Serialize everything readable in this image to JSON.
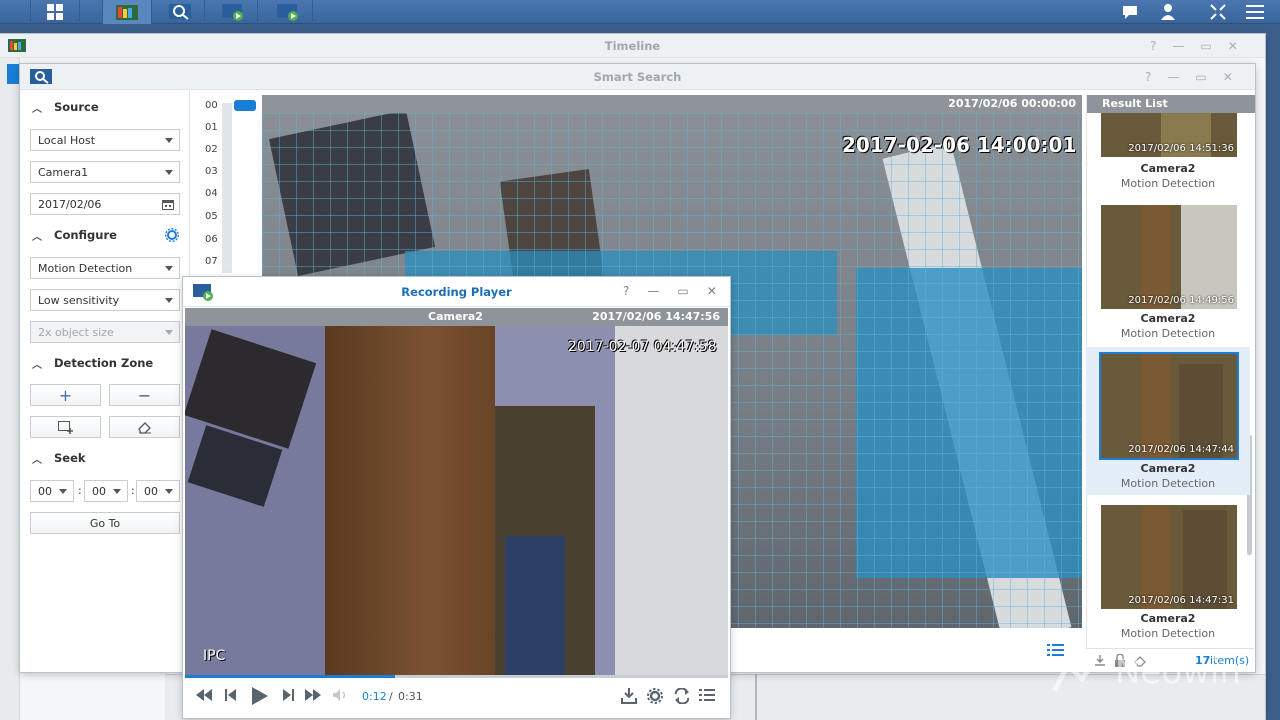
{
  "taskbar": {
    "icons": [
      "main-menu-icon",
      "timeline-app-icon",
      "smart-search-app-icon",
      "recording-player-app-icon",
      "recording-player-app-icon"
    ],
    "right_icons": [
      "notifications-icon",
      "user-icon",
      "fullscreen-icon",
      "menu-icon"
    ]
  },
  "timeline_window": {
    "title": "Timeline"
  },
  "smart_search": {
    "title": "Smart Search",
    "source": {
      "heading": "Source",
      "host": "Local Host",
      "camera": "Camera1",
      "date": "2017/02/06"
    },
    "configure": {
      "heading": "Configure",
      "mode": "Motion Detection",
      "sensitivity": "Low sensitivity",
      "object_size": "2x object size"
    },
    "detection_zone": {
      "heading": "Detection Zone"
    },
    "seek": {
      "heading": "Seek",
      "h": "00",
      "m": "00",
      "s": "00",
      "sep": ":",
      "goto": "Go To"
    },
    "hours": [
      "00",
      "01",
      "02",
      "03",
      "04",
      "05",
      "06",
      "07"
    ],
    "preview": {
      "header_time": "2017/02/06 00:00:00",
      "osd_time": "2017-02-06 14:00:01"
    },
    "results": {
      "heading": "Result List",
      "items": [
        {
          "time": "2017/02/06 14:51:36",
          "camera": "Camera2",
          "event": "Motion Detection"
        },
        {
          "time": "2017/02/06 14:49:56",
          "camera": "Camera2",
          "event": "Motion Detection"
        },
        {
          "time": "2017/02/06 14:47:44",
          "camera": "Camera2",
          "event": "Motion Detection",
          "selected": true
        },
        {
          "time": "2017/02/06 14:47:31",
          "camera": "Camera2",
          "event": "Motion Detection"
        }
      ],
      "count": "17",
      "count_label": "item(s)"
    }
  },
  "player": {
    "title": "Recording Player",
    "camera": "Camera2",
    "time": "2017/02/06 14:47:56",
    "osd_time": "2017-02-07 04:47:58",
    "osd_label": "IPC",
    "current": "0:12",
    "separator": "/",
    "total": "0:31",
    "progress": 0.387
  },
  "watermark": "Neowin",
  "colors": {
    "accent": "#1a7fd4",
    "taskbar": "#4a77b0",
    "zone": "#2a8fc0"
  }
}
